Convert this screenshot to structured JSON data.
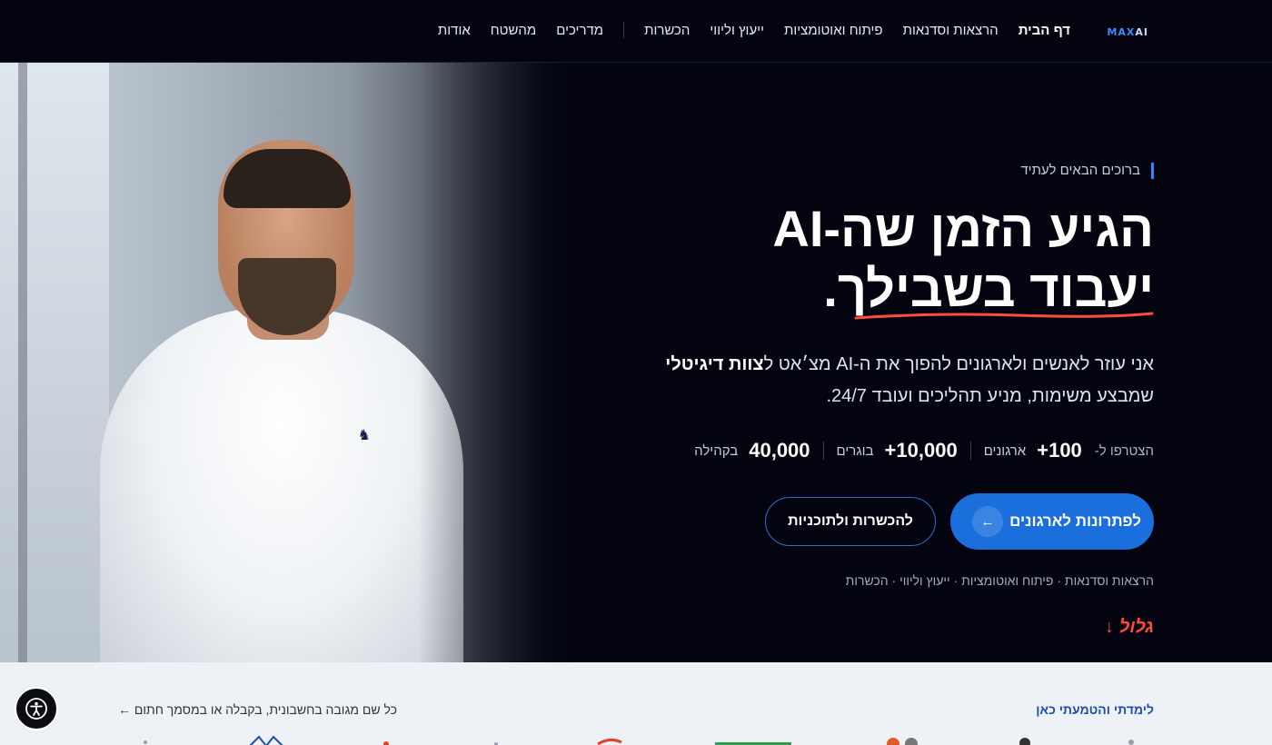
{
  "nav": {
    "logo": {
      "max": "MAX",
      "ai": "AI"
    },
    "links": [
      {
        "label": "דף הבית",
        "active": true
      },
      {
        "label": "הרצאות וסדנאות"
      },
      {
        "label": "פיתוח ואוטומציות"
      },
      {
        "label": "ייעוץ וליווי"
      },
      {
        "label": "הכשרות"
      },
      {
        "label": "מדריכים"
      },
      {
        "label": "מהשטח"
      },
      {
        "label": "אודות"
      }
    ]
  },
  "hero": {
    "eyebrow": "ברוכים הבאים לעתיד",
    "headline_line1": "הגיע הזמן שה-AI",
    "headline_line2": "יעבוד בשבילך.",
    "lead_part1": "אני עוזר לאנשים ולארגונים להפוך את ה-AI מצ׳אט ל",
    "lead_bold": "צוות דיגיטלי",
    "lead_part2": "שמבצע משימות, מניע תהליכים ועובד 24/7.",
    "stats_label": "הצטרפו ל-",
    "stats": [
      {
        "num": "100+",
        "unit": "ארגונים"
      },
      {
        "num": "10,000+",
        "unit": "בוגרים"
      },
      {
        "num": "40,000",
        "unit": "בקהילה"
      }
    ],
    "cta_primary": "לפתרונות לארגונים",
    "cta_secondary": "להכשרות ולתוכניות",
    "tagline": "הרצאות וסדנאות · פיתוח ואוטומציות · ייעוץ וליווי · הכשרות",
    "scroll_label": "גלול"
  },
  "trust": {
    "title": "לימדתי והטמעתי כאן",
    "note": "כל שם מגובה בחשבונית, בקבלה או במסמך חתום ←"
  },
  "colors": {
    "accent": "#1a6fdc",
    "brand_blue": "#3b8cff",
    "highlight": "#ff4c38",
    "background": "#03040f"
  }
}
